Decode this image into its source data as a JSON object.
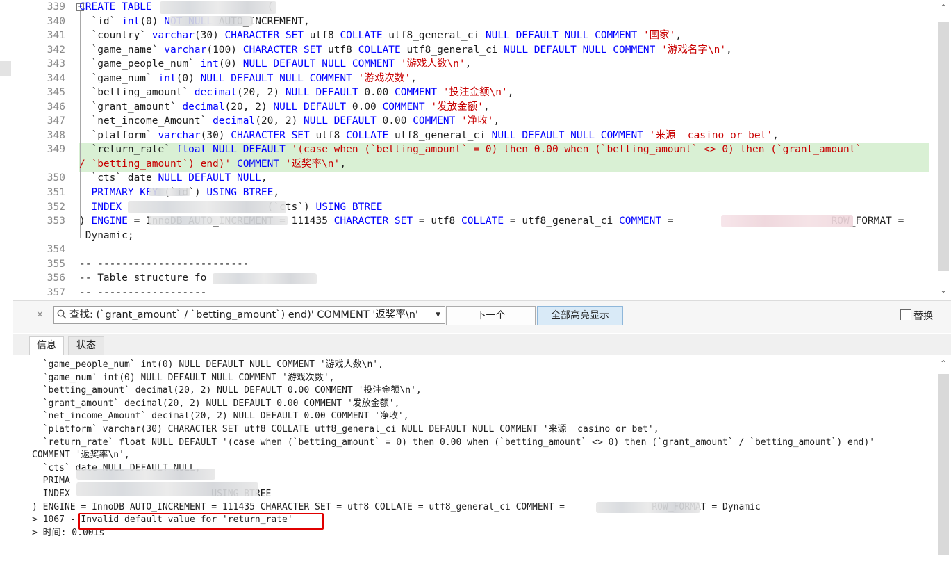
{
  "editor": {
    "lines": [
      {
        "no": "339",
        "indent": "",
        "parts": [
          [
            "kw",
            "CREATE TABLE"
          ],
          [
            "t",
            "                   ("
          ]
        ]
      },
      {
        "no": "340",
        "indent": "  ",
        "parts": [
          [
            "t",
            "`id` "
          ],
          [
            "kw",
            "int"
          ],
          [
            "t",
            "(0) "
          ],
          [
            "kw",
            "NOT NULL"
          ],
          [
            "t",
            " AUTO_INCREMENT,"
          ]
        ]
      },
      {
        "no": "341",
        "indent": "  ",
        "parts": [
          [
            "t",
            "`country` "
          ],
          [
            "kw",
            "varchar"
          ],
          [
            "t",
            "(30) "
          ],
          [
            "kw",
            "CHARACTER SET"
          ],
          [
            "t",
            " utf8 "
          ],
          [
            "kw",
            "COLLATE"
          ],
          [
            "t",
            " utf8_general_ci "
          ],
          [
            "kw",
            "NULL DEFAULT NULL COMMENT"
          ],
          [
            "t",
            " "
          ],
          [
            "str",
            "'国家'"
          ],
          [
            "t",
            ","
          ]
        ]
      },
      {
        "no": "342",
        "indent": "  ",
        "parts": [
          [
            "t",
            "`game_name` "
          ],
          [
            "kw",
            "varchar"
          ],
          [
            "t",
            "(100) "
          ],
          [
            "kw",
            "CHARACTER SET"
          ],
          [
            "t",
            " utf8 "
          ],
          [
            "kw",
            "COLLATE"
          ],
          [
            "t",
            " utf8_general_ci "
          ],
          [
            "kw",
            "NULL DEFAULT NULL COMMENT"
          ],
          [
            "t",
            " "
          ],
          [
            "str",
            "'游戏名字\\n'"
          ],
          [
            "t",
            ","
          ]
        ]
      },
      {
        "no": "343",
        "indent": "  ",
        "parts": [
          [
            "t",
            "`game_people_num` "
          ],
          [
            "kw",
            "int"
          ],
          [
            "t",
            "(0) "
          ],
          [
            "kw",
            "NULL DEFAULT NULL COMMENT"
          ],
          [
            "t",
            " "
          ],
          [
            "str",
            "'游戏人数\\n'"
          ],
          [
            "t",
            ","
          ]
        ]
      },
      {
        "no": "344",
        "indent": "  ",
        "parts": [
          [
            "t",
            "`game_num` "
          ],
          [
            "kw",
            "int"
          ],
          [
            "t",
            "(0) "
          ],
          [
            "kw",
            "NULL DEFAULT NULL COMMENT"
          ],
          [
            "t",
            " "
          ],
          [
            "str",
            "'游戏次数'"
          ],
          [
            "t",
            ","
          ]
        ]
      },
      {
        "no": "345",
        "indent": "  ",
        "parts": [
          [
            "t",
            "`betting_amount` "
          ],
          [
            "kw",
            "decimal"
          ],
          [
            "t",
            "(20, 2) "
          ],
          [
            "kw",
            "NULL DEFAULT"
          ],
          [
            "t",
            " 0.00 "
          ],
          [
            "kw",
            "COMMENT"
          ],
          [
            "t",
            " "
          ],
          [
            "str",
            "'投注金额\\n'"
          ],
          [
            "t",
            ","
          ]
        ]
      },
      {
        "no": "346",
        "indent": "  ",
        "parts": [
          [
            "t",
            "`grant_amount` "
          ],
          [
            "kw",
            "decimal"
          ],
          [
            "t",
            "(20, 2) "
          ],
          [
            "kw",
            "NULL DEFAULT"
          ],
          [
            "t",
            " 0.00 "
          ],
          [
            "kw",
            "COMMENT"
          ],
          [
            "t",
            " "
          ],
          [
            "str",
            "'发放金额'"
          ],
          [
            "t",
            ","
          ]
        ]
      },
      {
        "no": "347",
        "indent": "  ",
        "parts": [
          [
            "t",
            "`net_income_Amount` "
          ],
          [
            "kw",
            "decimal"
          ],
          [
            "t",
            "(20, 2) "
          ],
          [
            "kw",
            "NULL DEFAULT"
          ],
          [
            "t",
            " 0.00 "
          ],
          [
            "kw",
            "COMMENT"
          ],
          [
            "t",
            " "
          ],
          [
            "str",
            "'净收'"
          ],
          [
            "t",
            ","
          ]
        ]
      },
      {
        "no": "348",
        "indent": "  ",
        "parts": [
          [
            "t",
            "`platform` "
          ],
          [
            "kw",
            "varchar"
          ],
          [
            "t",
            "(30) "
          ],
          [
            "kw",
            "CHARACTER SET"
          ],
          [
            "t",
            " utf8 "
          ],
          [
            "kw",
            "COLLATE"
          ],
          [
            "t",
            " utf8_general_ci "
          ],
          [
            "kw",
            "NULL DEFAULT NULL COMMENT"
          ],
          [
            "t",
            " "
          ],
          [
            "str",
            "'来源  casino or bet'"
          ],
          [
            "t",
            ","
          ]
        ]
      },
      {
        "no": "349",
        "indent": "  ",
        "parts": [
          [
            "t",
            "`return_rate` "
          ],
          [
            "kw",
            "float NULL DEFAULT"
          ],
          [
            "t",
            " "
          ],
          [
            "str",
            "'(case when (`betting_amount` = 0) then 0.00 when (`betting_amount` <> 0) then (`grant_amount`"
          ]
        ]
      },
      {
        "no": "",
        "indent": "",
        "parts": [
          [
            "str",
            "/ `betting_amount`) end)'"
          ],
          [
            "t",
            " "
          ],
          [
            "kw",
            "COMMENT"
          ],
          [
            "t",
            " "
          ],
          [
            "str",
            "'返奖率\\n'"
          ],
          [
            "t",
            ","
          ]
        ]
      },
      {
        "no": "350",
        "indent": "  ",
        "parts": [
          [
            "t",
            "`cts` date "
          ],
          [
            "kw",
            "NULL DEFAULT NULL"
          ],
          [
            "t",
            ","
          ]
        ]
      },
      {
        "no": "351",
        "indent": "  ",
        "parts": [
          [
            "kw",
            "PRIMARY KEY"
          ],
          [
            "t",
            " (`id`) "
          ],
          [
            "kw",
            "USING BTREE"
          ],
          [
            "t",
            ","
          ]
        ]
      },
      {
        "no": "352",
        "indent": "  ",
        "parts": [
          [
            "kw",
            "INDEX"
          ],
          [
            "t",
            "                        (`cts`) "
          ],
          [
            "kw",
            "USING BTREE"
          ]
        ]
      },
      {
        "no": "353",
        "indent": "",
        "parts": [
          [
            "t",
            ") "
          ],
          [
            "kw",
            "ENGINE"
          ],
          [
            "t",
            " = InnoDB AUTO_INCREMENT = 111435 "
          ],
          [
            "kw",
            "CHARACTER SET"
          ],
          [
            "t",
            " = utf8 "
          ],
          [
            "kw",
            "COLLATE"
          ],
          [
            "t",
            " = utf8_general_ci "
          ],
          [
            "kw",
            "COMMENT"
          ],
          [
            "t",
            " =                          ROW_FORMAT ="
          ]
        ]
      },
      {
        "no": "",
        "indent": " ",
        "parts": [
          [
            "t",
            "Dynamic;"
          ]
        ]
      },
      {
        "no": "354",
        "indent": "",
        "parts": []
      },
      {
        "no": "355",
        "indent": "",
        "parts": [
          [
            "t",
            "-- -------------------------"
          ]
        ]
      },
      {
        "no": "356",
        "indent": "",
        "parts": [
          [
            "t",
            "-- Table structure fo"
          ]
        ]
      },
      {
        "no": "357",
        "indent": "",
        "parts": [
          [
            "t",
            "-- ------------------"
          ]
        ]
      }
    ]
  },
  "find": {
    "label": "查找: (`grant_amount` / `betting_amount`) end)' COMMENT '返奖率\\n'",
    "search_icon": "search-icon",
    "next_button": "下一个",
    "highlight_all_button": "全部高亮显示",
    "replace_label": "替换",
    "close_icon": "×"
  },
  "tabs": {
    "info": "信息",
    "status": "状态"
  },
  "log": {
    "lines": [
      "  `game_people_num` int(0) NULL DEFAULT NULL COMMENT '游戏人数\\n',",
      "  `game_num` int(0) NULL DEFAULT NULL COMMENT '游戏次数',",
      "  `betting_amount` decimal(20, 2) NULL DEFAULT 0.00 COMMENT '投注金额\\n',",
      "  `grant_amount` decimal(20, 2) NULL DEFAULT 0.00 COMMENT '发放金额',",
      "  `net_income_Amount` decimal(20, 2) NULL DEFAULT 0.00 COMMENT '净收',",
      "  `platform` varchar(30) CHARACTER SET utf8 COLLATE utf8_general_ci NULL DEFAULT NULL COMMENT '来源  casino or bet',",
      "  `return_rate` float NULL DEFAULT '(case when (`betting_amount` = 0) then 0.00 when (`betting_amount` <> 0) then (`grant_amount` / `betting_amount`) end)'",
      "COMMENT '返奖率\\n',",
      "  `cts` date NULL DEFAULT NULL,",
      "  PRIMA",
      "  INDEX                          USING BTREE",
      ") ENGINE = InnoDB AUTO_INCREMENT = 111435 CHARACTER SET = utf8 COLLATE = utf8_general_ci COMMENT =                ROW_FORMAT = Dynamic",
      "> 1067 - Invalid default value for 'return_rate'",
      "> 时间: 0.001s"
    ]
  }
}
